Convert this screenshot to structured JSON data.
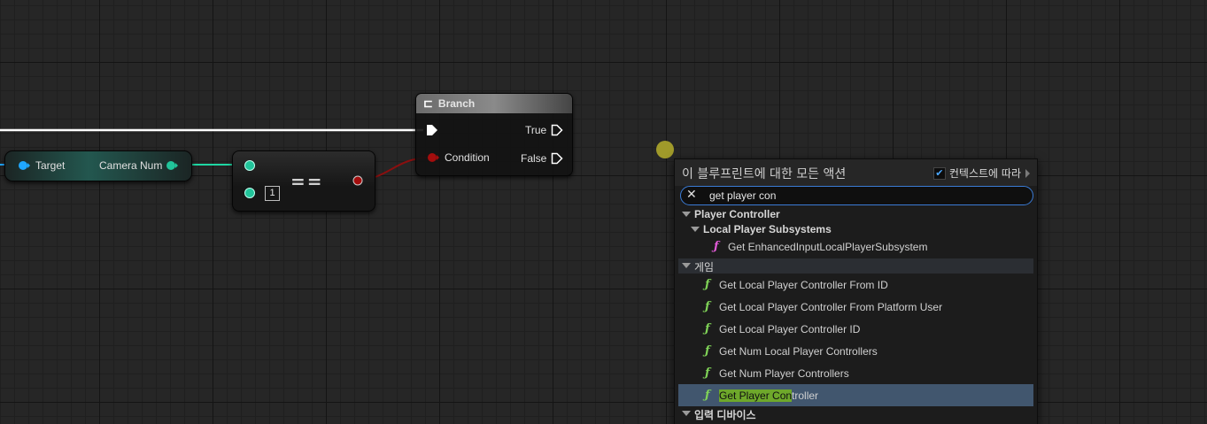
{
  "graph": {
    "getter_node": {
      "target_label": "Target",
      "output_label": "Camera Num"
    },
    "equals_node": {
      "operator": "==",
      "default_value": "1"
    },
    "branch_node": {
      "title": "Branch",
      "condition_label": "Condition",
      "true_label": "True",
      "false_label": "False"
    },
    "colors": {
      "exec_wire": "#ffffff",
      "int_wire": "#1fd7a3",
      "bool_wire": "#8a0f0f",
      "object_pin": "#1fa7ff",
      "int_pin": "#21c49a",
      "bool_pin": "#a30d0d",
      "drop_dot": "#a09a2a"
    }
  },
  "action_menu": {
    "title": "이 블루프린트에 대한 모든 액션",
    "context_label": "컨텍스트에 따라",
    "context_checked": true,
    "search_value": "get player con",
    "categories": [
      {
        "label": "Player Controller",
        "subcategories": [
          {
            "label": "Local Player Subsystems",
            "items": [
              {
                "label": "Get EnhancedInputLocalPlayerSubsystem",
                "icon": "function-icon",
                "color": "#e05ad6"
              }
            ]
          }
        ]
      },
      {
        "label": "게임",
        "items": [
          {
            "label": "Get Local Player Controller From ID",
            "icon": "function-icon",
            "color": "#7fd257"
          },
          {
            "label": "Get Local Player Controller From Platform User",
            "icon": "function-icon",
            "color": "#7fd257"
          },
          {
            "label": "Get Local Player Controller ID",
            "icon": "function-icon",
            "color": "#7fd257"
          },
          {
            "label": "Get Num Local Player Controllers",
            "icon": "function-icon",
            "color": "#7fd257"
          },
          {
            "label": "Get Num Player Controllers",
            "icon": "function-icon",
            "color": "#7fd257"
          },
          {
            "label_match": "Get Player Con",
            "label_rest": "troller",
            "icon": "function-icon",
            "color": "#7fd257",
            "selected": true
          }
        ]
      },
      {
        "label": "입력 디바이스"
      }
    ]
  }
}
